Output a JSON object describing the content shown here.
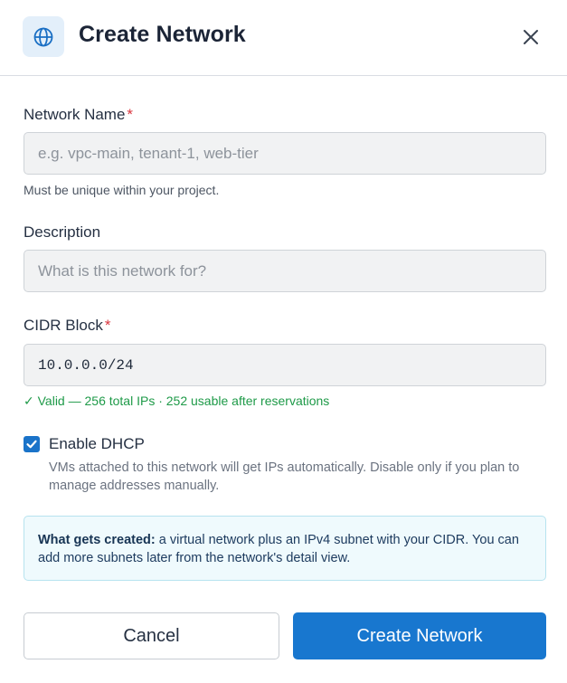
{
  "dialog": {
    "title": "Create Network",
    "icon": "globe-icon",
    "close_icon": "close-icon"
  },
  "fields": {
    "name": {
      "label": "Network Name",
      "required_marker": "*",
      "value": "",
      "placeholder": "e.g. vpc-main, tenant-1, web-tier",
      "hint": "Must be unique within your project."
    },
    "description": {
      "label": "Description",
      "value": "",
      "placeholder": "What is this network for?"
    },
    "cidr": {
      "label": "CIDR Block",
      "required_marker": "*",
      "value": "10.0.0.0/24",
      "validation": "✓ Valid — 256 total IPs · 252 usable after reservations"
    }
  },
  "dhcp": {
    "checked": true,
    "label": "Enable DHCP",
    "description": "VMs attached to this network will get IPs automatically. Disable only if you plan to manage addresses manually."
  },
  "info": {
    "heading": "What gets created:",
    "text": " a virtual network plus an IPv4 subnet with your CIDR. You can add more subnets later from the network's detail view."
  },
  "actions": {
    "cancel_label": "Cancel",
    "create_label": "Create Network"
  },
  "colors": {
    "accent": "#1877cf",
    "valid": "#1e9a48",
    "required": "#d9363e",
    "info_bg": "#effafd"
  }
}
